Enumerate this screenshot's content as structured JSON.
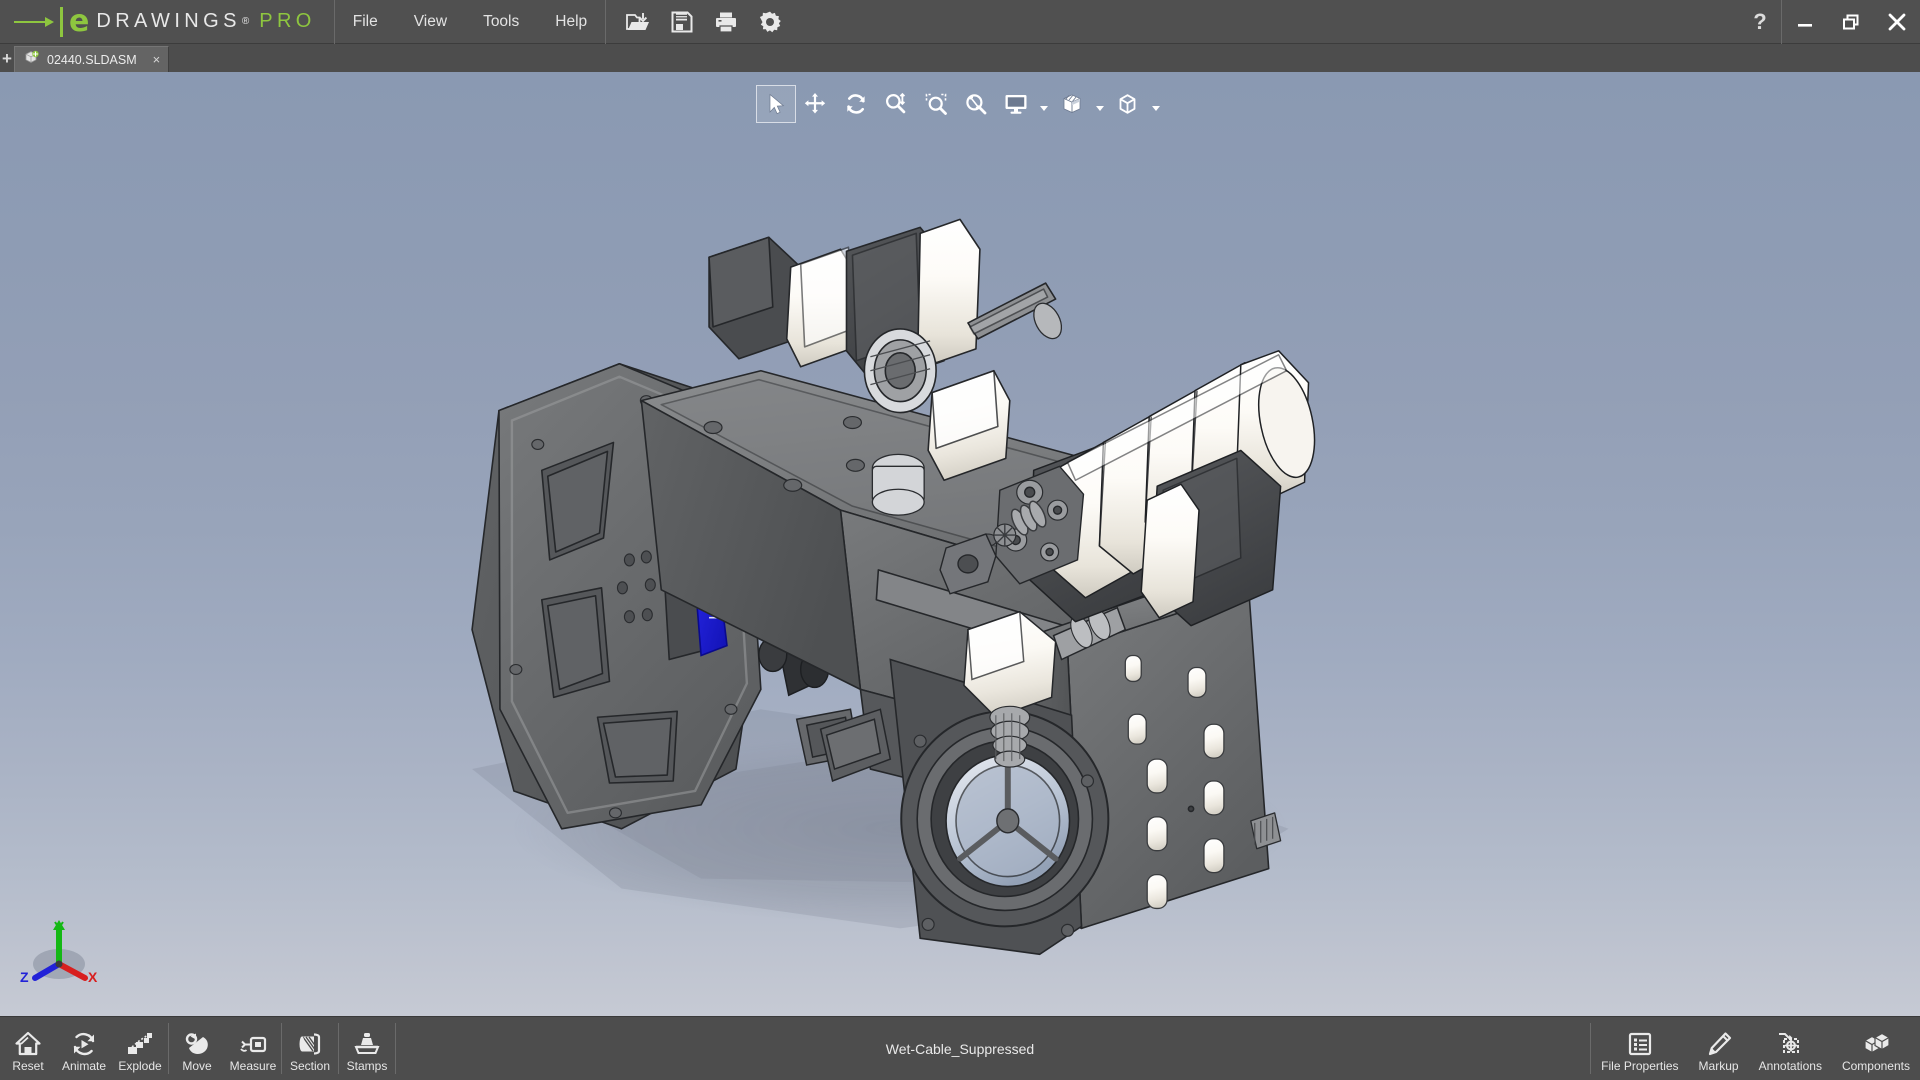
{
  "app": {
    "brand_e": "e",
    "brand_name": "DRAWINGS",
    "brand_reg": "®",
    "brand_edition": "PRO",
    "accent_color": "#8ec63f",
    "chrome_color": "#4d4d4d",
    "titlebar_color": "#505050"
  },
  "menu": {
    "items": [
      {
        "label": "File",
        "name": "menu-file"
      },
      {
        "label": "View",
        "name": "menu-view"
      },
      {
        "label": "Tools",
        "name": "menu-tools"
      },
      {
        "label": "Help",
        "name": "menu-help"
      }
    ]
  },
  "titlebar_icons": [
    {
      "name": "open-icon",
      "title": "Open"
    },
    {
      "name": "save-icon",
      "title": "Save"
    },
    {
      "name": "print-icon",
      "title": "Print"
    },
    {
      "name": "gear-icon",
      "title": "Options"
    }
  ],
  "window_controls": {
    "help": "?",
    "minimize": "minimize-icon",
    "restore": "restore-icon",
    "close": "close-icon"
  },
  "tabs": {
    "add_label": "+",
    "items": [
      {
        "label": "02440.SLDASM",
        "icon": "assembly-icon",
        "close": "×",
        "active": true
      }
    ]
  },
  "view_toolbar": {
    "tools": [
      {
        "name": "select-tool",
        "title": "Select",
        "active": true,
        "caret": false
      },
      {
        "name": "pan-tool",
        "title": "Pan",
        "active": false,
        "caret": false
      },
      {
        "name": "rotate-tool",
        "title": "Rotate",
        "active": false,
        "caret": false
      },
      {
        "name": "zoom-in-out-tool",
        "title": "Zoom In/Out",
        "active": false,
        "caret": false
      },
      {
        "name": "zoom-to-area-tool",
        "title": "Zoom to Area",
        "active": false,
        "caret": false
      },
      {
        "name": "zoom-to-fit-tool",
        "title": "Zoom to Fit",
        "active": false,
        "caret": false
      },
      {
        "name": "view-orientation-tool",
        "title": "View Orientation",
        "active": false,
        "caret": true
      },
      {
        "name": "display-style-tool",
        "title": "Display Style",
        "active": false,
        "caret": true
      },
      {
        "name": "perspective-tool",
        "title": "Perspective",
        "active": false,
        "caret": true
      }
    ]
  },
  "viewport": {
    "background_top": "#8a99b2",
    "background_bottom": "#c6cad4",
    "model_name": "02440.SLDASM",
    "model_body_color": "#6c6e70",
    "model_light_color": "#f4f2ee",
    "model_highlight_color": "#1f1fd6",
    "triad": {
      "x_label": "X",
      "x_color": "#d81f1f",
      "y_label": "Y",
      "y_color": "#14b814",
      "z_label": "Z",
      "z_color": "#2222d8"
    }
  },
  "bottom_toolbar": {
    "left_groups": [
      {
        "buttons": [
          {
            "label": "Reset",
            "name": "reset-button",
            "icon": "home-icon"
          },
          {
            "label": "Animate",
            "name": "animate-button",
            "icon": "animate-icon"
          },
          {
            "label": "Explode",
            "name": "explode-button",
            "icon": "explode-icon"
          }
        ]
      },
      {
        "buttons": [
          {
            "label": "Move",
            "name": "move-button",
            "icon": "move-component-icon"
          },
          {
            "label": "Measure",
            "name": "measure-button",
            "icon": "measure-icon"
          }
        ]
      },
      {
        "buttons": [
          {
            "label": "Section",
            "name": "section-button",
            "icon": "section-icon"
          }
        ]
      },
      {
        "buttons": [
          {
            "label": "Stamps",
            "name": "stamps-button",
            "icon": "stamp-icon"
          }
        ]
      }
    ],
    "right_buttons": [
      {
        "label": "File Properties",
        "name": "file-properties-button",
        "icon": "list-icon"
      },
      {
        "label": "Markup",
        "name": "markup-button",
        "icon": "pencil-icon"
      },
      {
        "label": "Annotations",
        "name": "annotations-button",
        "icon": "annotation-icon"
      },
      {
        "label": "Components",
        "name": "components-button",
        "icon": "components-icon"
      }
    ],
    "status": "Wet-Cable_Suppressed"
  }
}
